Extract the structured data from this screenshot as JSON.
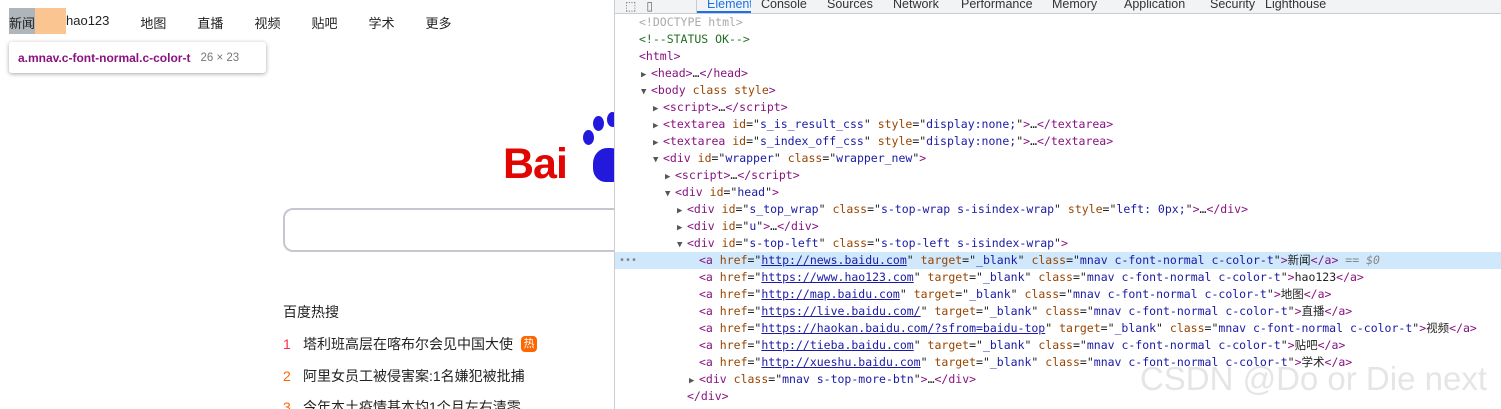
{
  "page": {
    "nav": [
      "新闻",
      "hao123",
      "地图",
      "直播",
      "视频",
      "贴吧",
      "学术",
      "更多"
    ],
    "tooltip": {
      "selector": "a.mnav.c-font-normal.c-color-t",
      "size": "26 × 23"
    },
    "logo_text": "Bai",
    "hot": {
      "title": "百度热搜",
      "items": [
        {
          "num": "1",
          "text": "塔利班高层在喀布尔会见中国大使",
          "badge": "热"
        },
        {
          "num": "2",
          "text": "阿里女员工被侵害案:1名嫌犯被批捕",
          "badge": ""
        },
        {
          "num": "3",
          "text": "今年本土疫情基本均1个月左右清零",
          "badge": ""
        }
      ]
    }
  },
  "devtools": {
    "tabs": [
      "Elements",
      "Console",
      "Sources",
      "Network",
      "Performance",
      "Memory",
      "Application",
      "Security",
      "Lighthouse"
    ],
    "active_tab": "Elements",
    "selected_suffix": "== $0",
    "lines": [
      {
        "indent": 0,
        "tri": "",
        "html": "<span class='gray'>&lt;!DOCTYPE html&gt;</span>"
      },
      {
        "indent": 0,
        "tri": "",
        "html": "<span class='cm'>&lt;!--STATUS OK--&gt;</span>"
      },
      {
        "indent": 0,
        "tri": "",
        "html": "<span class='tn'>&lt;html&gt;</span>"
      },
      {
        "indent": 1,
        "tri": "▶",
        "html": "<span class='tn'>&lt;head&gt;</span>…<span class='tn'>&lt;/head&gt;</span>"
      },
      {
        "indent": 1,
        "tri": "▼",
        "html": "<span class='tn'>&lt;body</span> <span class='an'>class</span> <span class='an'>style</span><span class='tn'>&gt;</span>"
      },
      {
        "indent": 2,
        "tri": "▶",
        "html": "<span class='tn'>&lt;script&gt;</span>…<span class='tn'>&lt;/script&gt;</span>"
      },
      {
        "indent": 2,
        "tri": "▶",
        "html": "<span class='tn'>&lt;textarea</span> <span class='an'>id</span>=\"<span class='av'>s_is_result_css</span>\" <span class='an'>style</span>=\"<span class='av'>display:none;</span>\"<span class='tn'>&gt;</span>…<span class='tn'>&lt;/textarea&gt;</span>"
      },
      {
        "indent": 2,
        "tri": "▶",
        "html": "<span class='tn'>&lt;textarea</span> <span class='an'>id</span>=\"<span class='av'>s_index_off_css</span>\" <span class='an'>style</span>=\"<span class='av'>display:none;</span>\"<span class='tn'>&gt;</span>…<span class='tn'>&lt;/textarea&gt;</span>"
      },
      {
        "indent": 2,
        "tri": "▼",
        "html": "<span class='tn'>&lt;div</span> <span class='an'>id</span>=\"<span class='av'>wrapper</span>\" <span class='an'>class</span>=\"<span class='av'>wrapper_new</span>\"<span class='tn'>&gt;</span>"
      },
      {
        "indent": 3,
        "tri": "▶",
        "html": "<span class='tn'>&lt;script&gt;</span>…<span class='tn'>&lt;/script&gt;</span>"
      },
      {
        "indent": 3,
        "tri": "▼",
        "html": "<span class='tn'>&lt;div</span> <span class='an'>id</span>=\"<span class='av'>head</span>\"<span class='tn'>&gt;</span>"
      },
      {
        "indent": 4,
        "tri": "▶",
        "html": "<span class='tn'>&lt;div</span> <span class='an'>id</span>=\"<span class='av'>s_top_wrap</span>\" <span class='an'>class</span>=\"<span class='av'>s-top-wrap s-isindex-wrap</span>\" <span class='an'>style</span>=\"<span class='av'>left: 0px;</span>\"<span class='tn'>&gt;</span>…<span class='tn'>&lt;/div&gt;</span>"
      },
      {
        "indent": 4,
        "tri": "▶",
        "html": "<span class='tn'>&lt;div</span> <span class='an'>id</span>=\"<span class='av'>u</span>\"<span class='tn'>&gt;</span>…<span class='tn'>&lt;/div&gt;</span>"
      },
      {
        "indent": 4,
        "tri": "▼",
        "html": "<span class='tn'>&lt;div</span> <span class='an'>id</span>=\"<span class='av'>s-top-left</span>\" <span class='an'>class</span>=\"<span class='av'>s-top-left s-isindex-wrap</span>\"<span class='tn'>&gt;</span>"
      },
      {
        "indent": 5,
        "tri": "",
        "selected": true,
        "html": "<span class='tn'>&lt;a</span> <span class='an'>href</span>=\"<span class='lk'>http://news.baidu.com</span>\" <span class='an'>target</span>=\"<span class='av'>_blank</span>\" <span class='an'>class</span>=\"<span class='av'>mnav c-font-normal c-color-t</span>\"<span class='tn'>&gt;</span>新闻<span class='tn'>&lt;/a&gt;</span>"
      },
      {
        "indent": 5,
        "tri": "",
        "html": "<span class='tn'>&lt;a</span> <span class='an'>href</span>=\"<span class='lk'>https://www.hao123.com</span>\" <span class='an'>target</span>=\"<span class='av'>_blank</span>\" <span class='an'>class</span>=\"<span class='av'>mnav c-font-normal c-color-t</span>\"<span class='tn'>&gt;</span>hao123<span class='tn'>&lt;/a&gt;</span>"
      },
      {
        "indent": 5,
        "tri": "",
        "html": "<span class='tn'>&lt;a</span> <span class='an'>href</span>=\"<span class='lk'>http://map.baidu.com</span>\" <span class='an'>target</span>=\"<span class='av'>_blank</span>\" <span class='an'>class</span>=\"<span class='av'>mnav c-font-normal c-color-t</span>\"<span class='tn'>&gt;</span>地图<span class='tn'>&lt;/a&gt;</span>"
      },
      {
        "indent": 5,
        "tri": "",
        "html": "<span class='tn'>&lt;a</span> <span class='an'>href</span>=\"<span class='lk'>https://live.baidu.com/</span>\" <span class='an'>target</span>=\"<span class='av'>_blank</span>\" <span class='an'>class</span>=\"<span class='av'>mnav c-font-normal c-color-t</span>\"<span class='tn'>&gt;</span>直播<span class='tn'>&lt;/a&gt;</span>"
      },
      {
        "indent": 5,
        "tri": "",
        "html": "<span class='tn'>&lt;a</span> <span class='an'>href</span>=\"<span class='lk'>https://haokan.baidu.com/?sfrom=baidu-top</span>\" <span class='an'>target</span>=\"<span class='av'>_blank</span>\" <span class='an'>class</span>=\"<span class='av'>mnav c-font-normal c-color-t</span>\"<span class='tn'>&gt;</span>视频<span class='tn'>&lt;/a&gt;</span>"
      },
      {
        "indent": 5,
        "tri": "",
        "html": "<span class='tn'>&lt;a</span> <span class='an'>href</span>=\"<span class='lk'>http://tieba.baidu.com</span>\" <span class='an'>target</span>=\"<span class='av'>_blank</span>\" <span class='an'>class</span>=\"<span class='av'>mnav c-font-normal c-color-t</span>\"<span class='tn'>&gt;</span>贴吧<span class='tn'>&lt;/a&gt;</span>"
      },
      {
        "indent": 5,
        "tri": "",
        "html": "<span class='tn'>&lt;a</span> <span class='an'>href</span>=\"<span class='lk'>http://xueshu.baidu.com</span>\" <span class='an'>target</span>=\"<span class='av'>_blank</span>\" <span class='an'>class</span>=\"<span class='av'>mnav c-font-normal c-color-t</span>\"<span class='tn'>&gt;</span>学术<span class='tn'>&lt;/a&gt;</span>"
      },
      {
        "indent": 5,
        "tri": "▶",
        "html": "<span class='tn'>&lt;div</span> <span class='an'>class</span>=\"<span class='av'>mnav s-top-more-btn</span>\"<span class='tn'>&gt;</span>…<span class='tn'>&lt;/div&gt;</span>"
      },
      {
        "indent": 4,
        "tri": "",
        "html": "<span class='tn'>&lt;/div&gt;</span>"
      }
    ]
  },
  "watermark": "CSDN @Do or Die next"
}
